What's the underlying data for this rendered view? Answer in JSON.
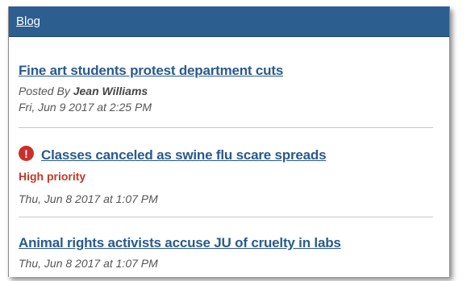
{
  "blog": {
    "header_label": "Blog",
    "posts": [
      {
        "title": "Fine art students protest department cuts",
        "posted_by_prefix": "Posted By",
        "author": "Jean Williams",
        "date": "Fri, Jun 9 2017 at 2:25 PM"
      },
      {
        "title": "Classes canceled as swine flu scare spreads",
        "priority": "High priority",
        "alert_icon": "exclamation-circle-icon",
        "date": "Thu, Jun 8 2017 at 1:07 PM"
      },
      {
        "title": "Animal rights activists accuse JU of cruelty in labs",
        "date": "Thu, Jun 8 2017 at 1:07 PM"
      }
    ]
  },
  "colors": {
    "header_bg": "#2c5f90",
    "link": "#2a5a8c",
    "priority": "#c0392b",
    "alert_icon": "#c9302c"
  }
}
